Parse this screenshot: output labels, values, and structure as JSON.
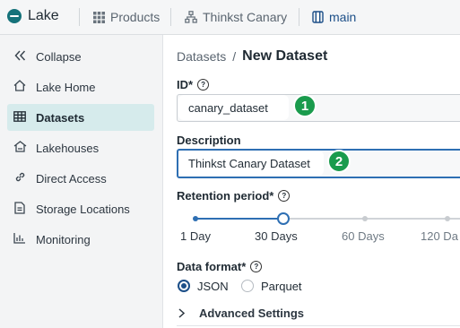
{
  "topbar": {
    "brand": "Lake",
    "products": "Products",
    "canary": "Thinkst Canary",
    "branch": "main"
  },
  "sidebar": {
    "items": [
      {
        "label": "Collapse",
        "icon": "double-chevron-left-icon"
      },
      {
        "label": "Lake Home",
        "icon": "home-icon"
      },
      {
        "label": "Datasets",
        "icon": "table-icon"
      },
      {
        "label": "Lakehouses",
        "icon": "lakehouse-icon"
      },
      {
        "label": "Direct Access",
        "icon": "link-icon"
      },
      {
        "label": "Storage Locations",
        "icon": "document-icon"
      },
      {
        "label": "Monitoring",
        "icon": "chart-icon"
      }
    ],
    "active": "Datasets"
  },
  "breadcrumb": {
    "parent": "Datasets",
    "separator": "/",
    "current": "New Dataset"
  },
  "form": {
    "id_label": "ID*",
    "id_value": "canary_dataset",
    "description_label": "Description",
    "description_value": "Thinkst Canary Dataset",
    "retention_label": "Retention period*",
    "retention_options": [
      "1 Day",
      "30 Days",
      "60 Days",
      "120 Da"
    ],
    "retention_selected": "30 Days",
    "format_label": "Data format*",
    "format_options": [
      "JSON",
      "Parquet"
    ],
    "format_selected": "JSON",
    "advanced_label": "Advanced Settings"
  },
  "annotations": {
    "marker1": "1",
    "marker2": "2"
  },
  "colors": {
    "accent": "#1c4f88",
    "teal": "#15727a",
    "marker": "#1a9b4d",
    "active_bg": "#d6ebec"
  }
}
